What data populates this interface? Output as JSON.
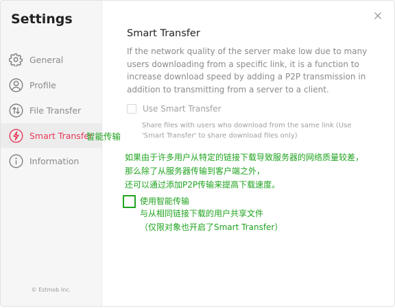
{
  "sidebar": {
    "title": "Settings",
    "items": [
      {
        "label": "General",
        "icon": "gear-icon"
      },
      {
        "label": "Profile",
        "icon": "user-icon"
      },
      {
        "label": "File Transfer",
        "icon": "transfer-icon"
      },
      {
        "label": "Smart Transfer",
        "icon": "lightning-icon",
        "annotation": "智能传输"
      },
      {
        "label": "Information",
        "icon": "info-icon"
      }
    ],
    "copyright": "© Estmob Inc."
  },
  "main": {
    "title": "Smart Transfer",
    "description": "If the network quality of the server make low due to many users downloading from a specific link, it is a function to increase download speed by adding a P2P transmission in addition to transmitting from a server to a client.",
    "option_label": "Use Smart Transfer",
    "option_description": "Share files with users who download from the same link (Use 'Smart Transfer' to share download files only)"
  },
  "annotation": {
    "description_lines": [
      "如果由于许多用户从特定的链接下载导致服务器的网络质量较差，",
      "那么除了从服务器传输到客户端之外，",
      "还可以通过添加P2P传输来提高下载速度。"
    ],
    "option_label": "使用智能传输",
    "option_lines": [
      "与从相同链接下载的用户共享文件",
      "（仅限对象也开启了Smart Transfer）"
    ]
  },
  "colors": {
    "accent": "#e8395a",
    "annotation": "#1fa31f",
    "muted": "#8a8a8a"
  }
}
